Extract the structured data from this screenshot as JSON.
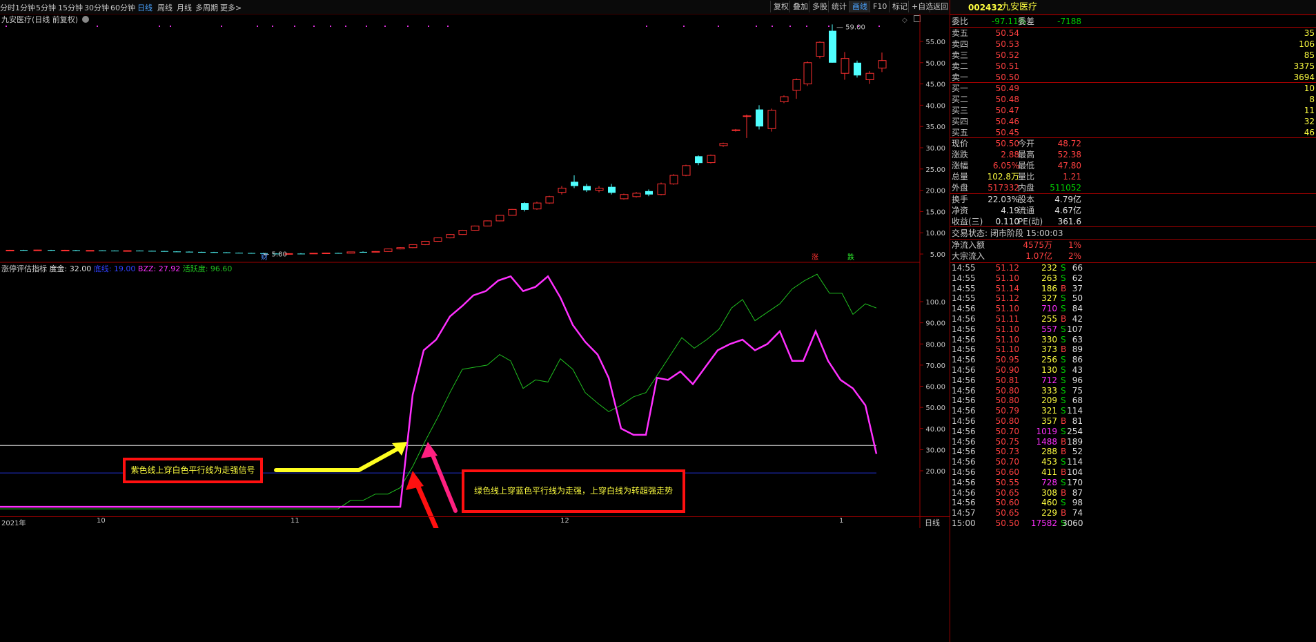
{
  "toolbar": {
    "left": [
      "分时",
      "1分钟",
      "5分钟",
      "15分钟",
      "30分钟",
      "60分钟",
      "日线",
      "周线",
      "月线",
      "多周期",
      "更多>"
    ],
    "active": "日线",
    "right": [
      "复权",
      "叠加",
      "多股",
      "统计",
      "画线",
      "F10",
      "标记",
      "+自选",
      "返回"
    ],
    "right_active": "画线"
  },
  "main_chart": {
    "title": "九安医疗(日线 前复权)",
    "price_ticks": [
      "55.00",
      "50.00",
      "45.00",
      "40.00",
      "35.00",
      "30.00",
      "25.00",
      "20.00",
      "15.00",
      "10.00",
      "5.00"
    ],
    "high_label": "59.00",
    "low_label": "5.80",
    "event_labels": {
      "cai": "财",
      "zhang": "涨",
      "die": "跌"
    }
  },
  "indicator": {
    "name": "涨停评估指标",
    "params": [
      {
        "text": "度金: 32.00",
        "color": "#e0e0e0"
      },
      {
        "text": "底线: 19.00",
        "color": "#3040ff"
      },
      {
        "text": "BZZ: 27.92",
        "color": "#ff30ff"
      },
      {
        "text": "活跃度: 96.60",
        "color": "#20c020"
      }
    ],
    "ticks": [
      "100.0",
      "90.00",
      "80.00",
      "70.00",
      "60.00",
      "50.00",
      "40.00",
      "30.00",
      "20.00"
    ],
    "annotation_left": "紫色线上穿白色平行线为走强信号",
    "annotation_right": "绿色线上穿蓝色平行线为走强，上穿白线为转超强走势"
  },
  "x_axis": {
    "labels": [
      "2021年",
      "10",
      "11",
      "12",
      "1"
    ],
    "corner": "日线"
  },
  "colors": {
    "up": "#ff3030",
    "down": "#50ffff",
    "bzz": "#ff30ff",
    "active": "#20c020",
    "white_line": "#e0e0e0",
    "blue_line": "#2030d0"
  },
  "panel": {
    "code": "002432",
    "name": "九安医疗",
    "webi_label": "委比",
    "webi": "-97.11%",
    "wecha_label": "委差",
    "wecha": "-7188",
    "asks": [
      {
        "label": "卖五",
        "price": "50.54",
        "vol": "35"
      },
      {
        "label": "卖四",
        "price": "50.53",
        "vol": "106"
      },
      {
        "label": "卖三",
        "price": "50.52",
        "vol": "85"
      },
      {
        "label": "卖二",
        "price": "50.51",
        "vol": "3375"
      },
      {
        "label": "卖一",
        "price": "50.50",
        "vol": "3694"
      }
    ],
    "bids": [
      {
        "label": "买一",
        "price": "50.49",
        "vol": "10"
      },
      {
        "label": "买二",
        "price": "50.48",
        "vol": "8"
      },
      {
        "label": "买三",
        "price": "50.47",
        "vol": "11"
      },
      {
        "label": "买四",
        "price": "50.46",
        "vol": "32"
      },
      {
        "label": "买五",
        "price": "50.45",
        "vol": "46"
      }
    ],
    "stats": [
      {
        "l1": "现价",
        "v1": "50.50",
        "c1": "red",
        "l2": "今开",
        "v2": "48.72",
        "c2": "red"
      },
      {
        "l1": "涨跌",
        "v1": "2.88",
        "c1": "red",
        "l2": "最高",
        "v2": "52.38",
        "c2": "red"
      },
      {
        "l1": "涨幅",
        "v1": "6.05%",
        "c1": "red",
        "l2": "最低",
        "v2": "47.80",
        "c2": "red"
      },
      {
        "l1": "总量",
        "v1": "102.8万",
        "c1": "yellow",
        "l2": "量比",
        "v2": "1.21",
        "c2": "red"
      },
      {
        "l1": "外盘",
        "v1": "517332",
        "c1": "red",
        "l2": "内盘",
        "v2": "511052",
        "c2": "green"
      }
    ],
    "stats2": [
      {
        "l1": "换手",
        "v1": "22.03%",
        "l2": "股本",
        "v2": "4.79亿"
      },
      {
        "l1": "净资",
        "v1": "4.19",
        "l2": "流通",
        "v2": "4.67亿"
      },
      {
        "l1": "收益(三)",
        "v1": "0.110",
        "l2": "PE(动)",
        "v2": "361.6"
      }
    ],
    "status": "交易状态: 闭市阶段 15:00:03",
    "flow": [
      {
        "label": "净流入额",
        "val": "4575万",
        "pct": "1%"
      },
      {
        "label": "大宗流入",
        "val": "1.07亿",
        "pct": "2%"
      }
    ],
    "ticks": [
      [
        "14:55",
        "51.12",
        "232",
        "S",
        "66"
      ],
      [
        "14:55",
        "51.10",
        "263",
        "S",
        "62"
      ],
      [
        "14:55",
        "51.14",
        "186",
        "B",
        "37"
      ],
      [
        "14:55",
        "51.12",
        "327",
        "S",
        "50"
      ],
      [
        "14:56",
        "51.10",
        "710",
        "S",
        "84"
      ],
      [
        "14:56",
        "51.11",
        "255",
        "B",
        "42"
      ],
      [
        "14:56",
        "51.10",
        "557",
        "S",
        "107"
      ],
      [
        "14:56",
        "51.10",
        "330",
        "S",
        "63"
      ],
      [
        "14:56",
        "51.10",
        "373",
        "B",
        "89"
      ],
      [
        "14:56",
        "50.95",
        "256",
        "S",
        "86"
      ],
      [
        "14:56",
        "50.90",
        "130",
        "S",
        "43"
      ],
      [
        "14:56",
        "50.81",
        "712",
        "S",
        "96"
      ],
      [
        "14:56",
        "50.80",
        "333",
        "S",
        "75"
      ],
      [
        "14:56",
        "50.80",
        "209",
        "S",
        "68"
      ],
      [
        "14:56",
        "50.79",
        "321",
        "S",
        "114"
      ],
      [
        "14:56",
        "50.80",
        "357",
        "B",
        "81"
      ],
      [
        "14:56",
        "50.70",
        "1019",
        "S",
        "254"
      ],
      [
        "14:56",
        "50.75",
        "1488",
        "B",
        "189"
      ],
      [
        "14:56",
        "50.73",
        "288",
        "B",
        "52"
      ],
      [
        "14:56",
        "50.70",
        "453",
        "S",
        "114"
      ],
      [
        "14:56",
        "50.60",
        "411",
        "B",
        "104"
      ],
      [
        "14:56",
        "50.55",
        "728",
        "S",
        "170"
      ],
      [
        "14:56",
        "50.65",
        "308",
        "B",
        "87"
      ],
      [
        "14:56",
        "50.60",
        "460",
        "S",
        "98"
      ],
      [
        "14:57",
        "50.65",
        "229",
        "B",
        "74"
      ],
      [
        "15:00",
        "50.50",
        "17582",
        "S",
        "3060"
      ]
    ]
  }
}
